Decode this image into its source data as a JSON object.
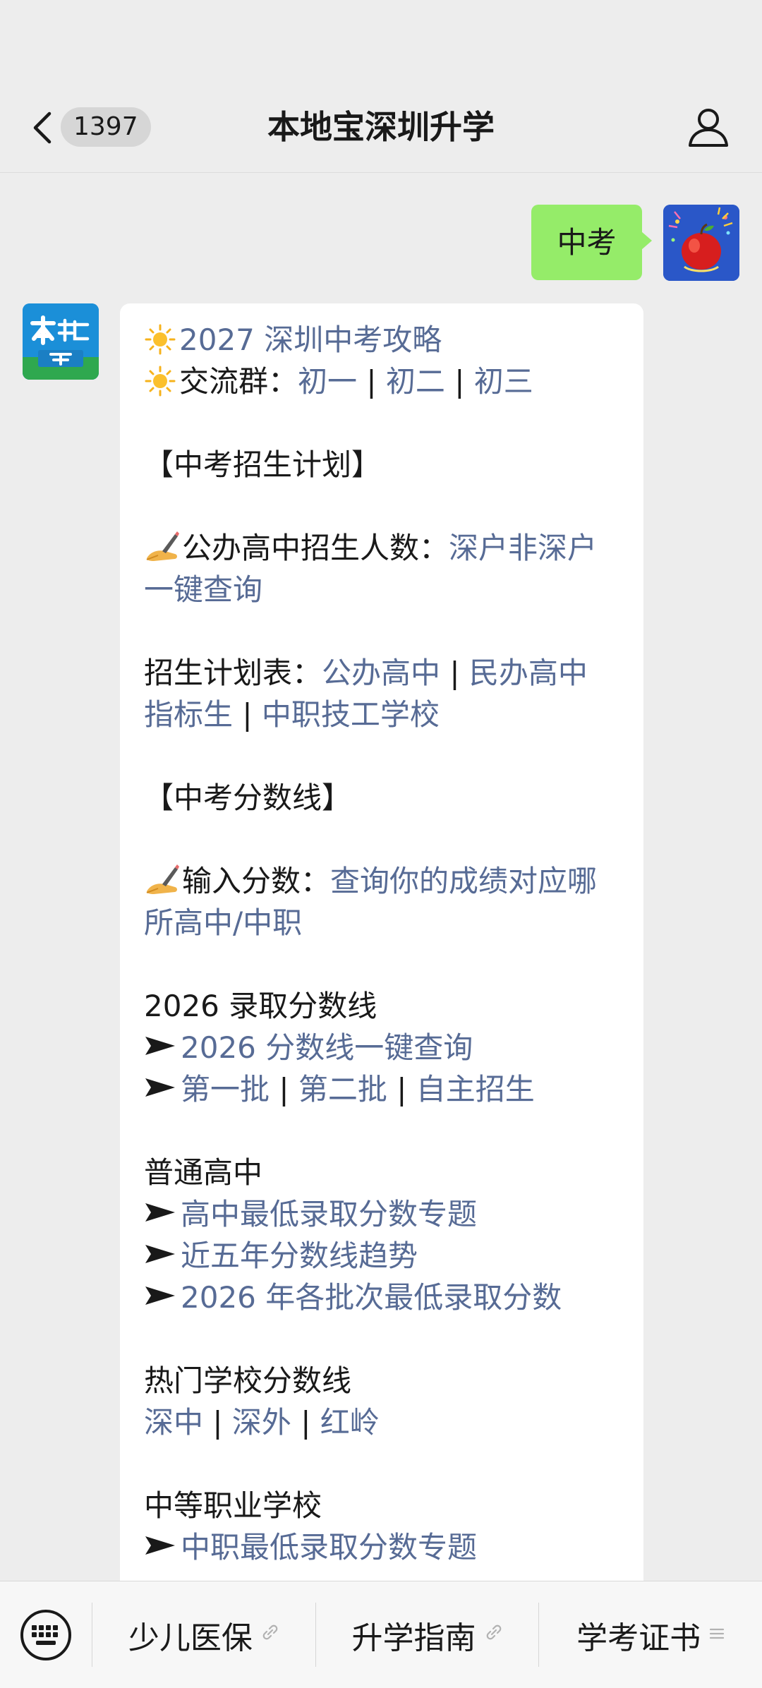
{
  "header": {
    "unread_count": "1397",
    "title": "本地宝深圳升学"
  },
  "outgoing": {
    "text": "中考"
  },
  "message": {
    "lines": [
      {
        "segments": [
          {
            "t": "2027 深圳中考攻略",
            "link": true
          }
        ],
        "icon": "sun"
      },
      {
        "segments": [
          {
            "t": "交流群：",
            "link": false
          },
          {
            "t": "初一",
            "link": true
          },
          {
            "t": " | ",
            "link": false
          },
          {
            "t": "初二",
            "link": true
          },
          {
            "t": " | ",
            "link": false
          },
          {
            "t": "初三",
            "link": true
          }
        ],
        "icon": "sun"
      },
      {
        "blank": true
      },
      {
        "segments": [
          {
            "t": "【中考招生计划】",
            "link": false
          }
        ]
      },
      {
        "blank": true
      },
      {
        "segments": [
          {
            "t": "公办高中招生人数：",
            "link": false
          },
          {
            "t": "深户非深户",
            "link": true
          }
        ],
        "icon": "pen"
      },
      {
        "segments": [
          {
            "t": "一键查询",
            "link": true
          }
        ]
      },
      {
        "blank": true
      },
      {
        "segments": [
          {
            "t": "招生计划表：",
            "link": false
          },
          {
            "t": "公办高中",
            "link": true
          },
          {
            "t": " | ",
            "link": false
          },
          {
            "t": "民办高中",
            "link": true
          }
        ]
      },
      {
        "segments": [
          {
            "t": "指标生",
            "link": true
          },
          {
            "t": " | ",
            "link": false
          },
          {
            "t": "中职技工学校",
            "link": true
          }
        ]
      },
      {
        "blank": true
      },
      {
        "segments": [
          {
            "t": "【中考分数线】",
            "link": false
          }
        ]
      },
      {
        "blank": true
      },
      {
        "segments": [
          {
            "t": "输入分数：",
            "link": false
          },
          {
            "t": "查询你的成绩对应哪",
            "link": true
          }
        ],
        "icon": "pen"
      },
      {
        "segments": [
          {
            "t": "所高中/中职",
            "link": true
          }
        ]
      },
      {
        "blank": true
      },
      {
        "segments": [
          {
            "t": "2026 录取分数线",
            "link": false
          }
        ]
      },
      {
        "segments": [
          {
            "t": "2026 分数线一键查询",
            "link": true
          }
        ],
        "icon": "arrow"
      },
      {
        "segments": [
          {
            "t": "第一批",
            "link": true
          },
          {
            "t": " | ",
            "link": false
          },
          {
            "t": "第二批",
            "link": true
          },
          {
            "t": " | ",
            "link": false
          },
          {
            "t": "自主招生",
            "link": true
          }
        ],
        "icon": "arrow"
      },
      {
        "blank": true
      },
      {
        "segments": [
          {
            "t": "普通高中",
            "link": false
          }
        ]
      },
      {
        "segments": [
          {
            "t": "高中最低录取分数专题",
            "link": true
          }
        ],
        "icon": "arrow"
      },
      {
        "segments": [
          {
            "t": "近五年分数线趋势",
            "link": true
          }
        ],
        "icon": "arrow"
      },
      {
        "segments": [
          {
            "t": "2026 年各批次最低录取分数",
            "link": true
          }
        ],
        "icon": "arrow"
      },
      {
        "blank": true
      },
      {
        "segments": [
          {
            "t": "热门学校分数线",
            "link": false
          }
        ]
      },
      {
        "segments": [
          {
            "t": "深中",
            "link": true
          },
          {
            "t": " | ",
            "link": false
          },
          {
            "t": "深外",
            "link": true
          },
          {
            "t": " | ",
            "link": false
          },
          {
            "t": "红岭",
            "link": true
          }
        ]
      },
      {
        "blank": true
      },
      {
        "segments": [
          {
            "t": "中等职业学校",
            "link": false
          }
        ]
      },
      {
        "segments": [
          {
            "t": "中职最低录取分数专题",
            "link": true
          }
        ],
        "icon": "arrow"
      }
    ]
  },
  "menu": {
    "items": [
      {
        "label": "少儿医保",
        "icon": "link-icon"
      },
      {
        "label": "升学指南",
        "icon": "link-icon"
      },
      {
        "label": "学考证书",
        "icon": "menu-lines-icon"
      }
    ]
  },
  "colors": {
    "link": "#576b95",
    "bubble_out": "#95ec69",
    "background": "#ededed"
  }
}
